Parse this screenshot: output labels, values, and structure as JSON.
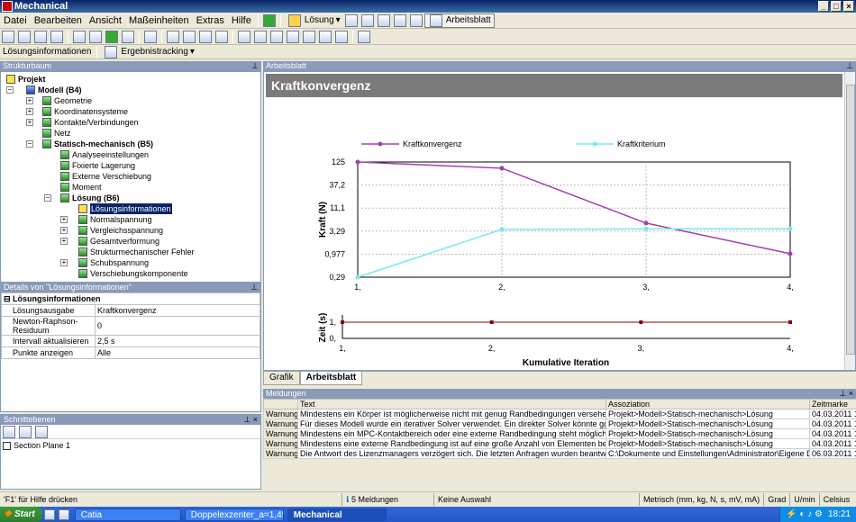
{
  "window": {
    "title": "Mechanical"
  },
  "menu": [
    "Datei",
    "Bearbeiten",
    "Ansicht",
    "Maßeinheiten",
    "Extras",
    "Hilfe"
  ],
  "toolbar": {
    "loesung": "Lösung",
    "arbeitsblatt": "Arbeitsblatt"
  },
  "toolbar3": {
    "loesungsinfo": "Lösungsinformationen",
    "ergebnistracking": "Ergebnistracking"
  },
  "strukturbaum": {
    "header": "Strukturbaum"
  },
  "tree": [
    {
      "label": "Projekt",
      "bold": true
    },
    {
      "label": "Modell (B4)",
      "bold": true
    },
    {
      "label": "Geometrie"
    },
    {
      "label": "Koordinatensysteme"
    },
    {
      "label": "Kontakte/Verbindungen"
    },
    {
      "label": "Netz"
    },
    {
      "label": "Statisch-mechanisch (B5)",
      "bold": true
    },
    {
      "label": "Analyseeinstellungen"
    },
    {
      "label": "Fixierte Lagerung"
    },
    {
      "label": "Externe Verschiebung"
    },
    {
      "label": "Moment"
    },
    {
      "label": "Lösung (B6)",
      "bold": true
    },
    {
      "label": "Lösungsinformationen"
    },
    {
      "label": "Normalspannung"
    },
    {
      "label": "Vergleichsspannung"
    },
    {
      "label": "Gesamtverformung"
    },
    {
      "label": "Strukturmechanischer Fehler"
    },
    {
      "label": "Schubspannung"
    },
    {
      "label": "Verschiebungskomponente"
    }
  ],
  "details": {
    "header": "Details von \"Lösungsinformationen\"",
    "group": "Lösungsinformationen",
    "rows": [
      {
        "k": "Lösungsausgabe",
        "v": "Kraftkonvergenz"
      },
      {
        "k": "Newton-Raphson-Residuum",
        "v": "0"
      },
      {
        "k": "Intervall aktualisieren",
        "v": "2,5 s"
      },
      {
        "k": "Punkte anzeigen",
        "v": "Alle"
      }
    ]
  },
  "schnitt": {
    "header": "Schnittebenen",
    "item": "Section Plane 1"
  },
  "worksheet": {
    "header": "Arbeitsblatt",
    "title": "Kraftkonvergenz",
    "tabs": [
      "Grafik",
      "Arbeitsblatt"
    ]
  },
  "chart_data": [
    {
      "type": "line",
      "ylabel": "Kraft (N)",
      "x": [
        1,
        2,
        3,
        4
      ],
      "yticks": [
        "0,29",
        "0,977",
        "3,29",
        "11,1",
        "37,2",
        "125"
      ],
      "xticks": [
        "1,",
        "2,",
        "3,",
        "4,"
      ],
      "scale": "log",
      "series": [
        {
          "name": "Kraftkonvergenz",
          "color": "#a040b0",
          "values": [
            125,
            90,
            5.0,
            1.0
          ]
        },
        {
          "name": "Kraftkriterium",
          "color": "#7de6f0",
          "values": [
            0.29,
            3.6,
            3.7,
            3.7
          ]
        }
      ],
      "legend": "top"
    },
    {
      "type": "line",
      "ylabel": "Zeit (s)",
      "xlabel": "Kumulative Iteration",
      "yticks": [
        "0,",
        "1,"
      ],
      "xticks": [
        "1,",
        "2,",
        "3,",
        "4,"
      ],
      "series": [
        {
          "color": "#8b0000",
          "values": [
            1,
            1,
            1,
            1
          ]
        }
      ]
    }
  ],
  "messages": {
    "header": "Meldungen",
    "cols": [
      "Text",
      "Assoziation",
      "Zeitmarke"
    ],
    "rows": [
      {
        "t": "Warnung",
        "text": "Mindestens ein Körper ist möglicherweise nicht mit genug Randbedingungen versehen, so dass s",
        "assoc": "Projekt>Modell>Statisch-mechanisch>Lösung",
        "time": "04.03.2011 1"
      },
      {
        "t": "Warnung",
        "text": "Für dieses Modell wurde ein iterativer Solver verwendet.  Ein direkter Solver könnte ggf. die Leis",
        "assoc": "Projekt>Modell>Statisch-mechanisch>Lösung",
        "time": "04.03.2011 1"
      },
      {
        "t": "Warnung",
        "text": "Mindestens ein MPC-Kontaktbereich oder eine externe Randbedingung steht möglicherweise in K",
        "assoc": "Projekt>Modell>Statisch-mechanisch>Lösung",
        "time": "04.03.2011 1"
      },
      {
        "t": "Warnung",
        "text": "Mindestens eine externe Randbedingung ist auf eine große Anzahl von Elementen begrenzt, wa",
        "assoc": "Projekt>Modell>Statisch-mechanisch>Lösung",
        "time": "04.03.2011 1"
      },
      {
        "t": "Warnung",
        "text": "Die Antwort des Lizenzmanagers verzögert sich. Die letzten Anfragen wurden beantwortet nach",
        "assoc": "C:\\Dokumente und Einstellungen\\Administrator\\Eigene Dateien",
        "time": "06.03.2011 1"
      }
    ]
  },
  "status": {
    "help": "'F1' für Hilfe drücken",
    "count": "5 Meldungen",
    "sel": "Keine Auswahl",
    "units": "Metrisch (mm, kg, N, s, mV, mA)",
    "grad": "Grad",
    "umin": "U/min",
    "celsius": "Celsius"
  },
  "taskbar": {
    "start": "Start",
    "tasks": [
      "Catia",
      "Doppelexzenter_a=1,45...",
      "Mechanical"
    ],
    "time": "18:21"
  }
}
